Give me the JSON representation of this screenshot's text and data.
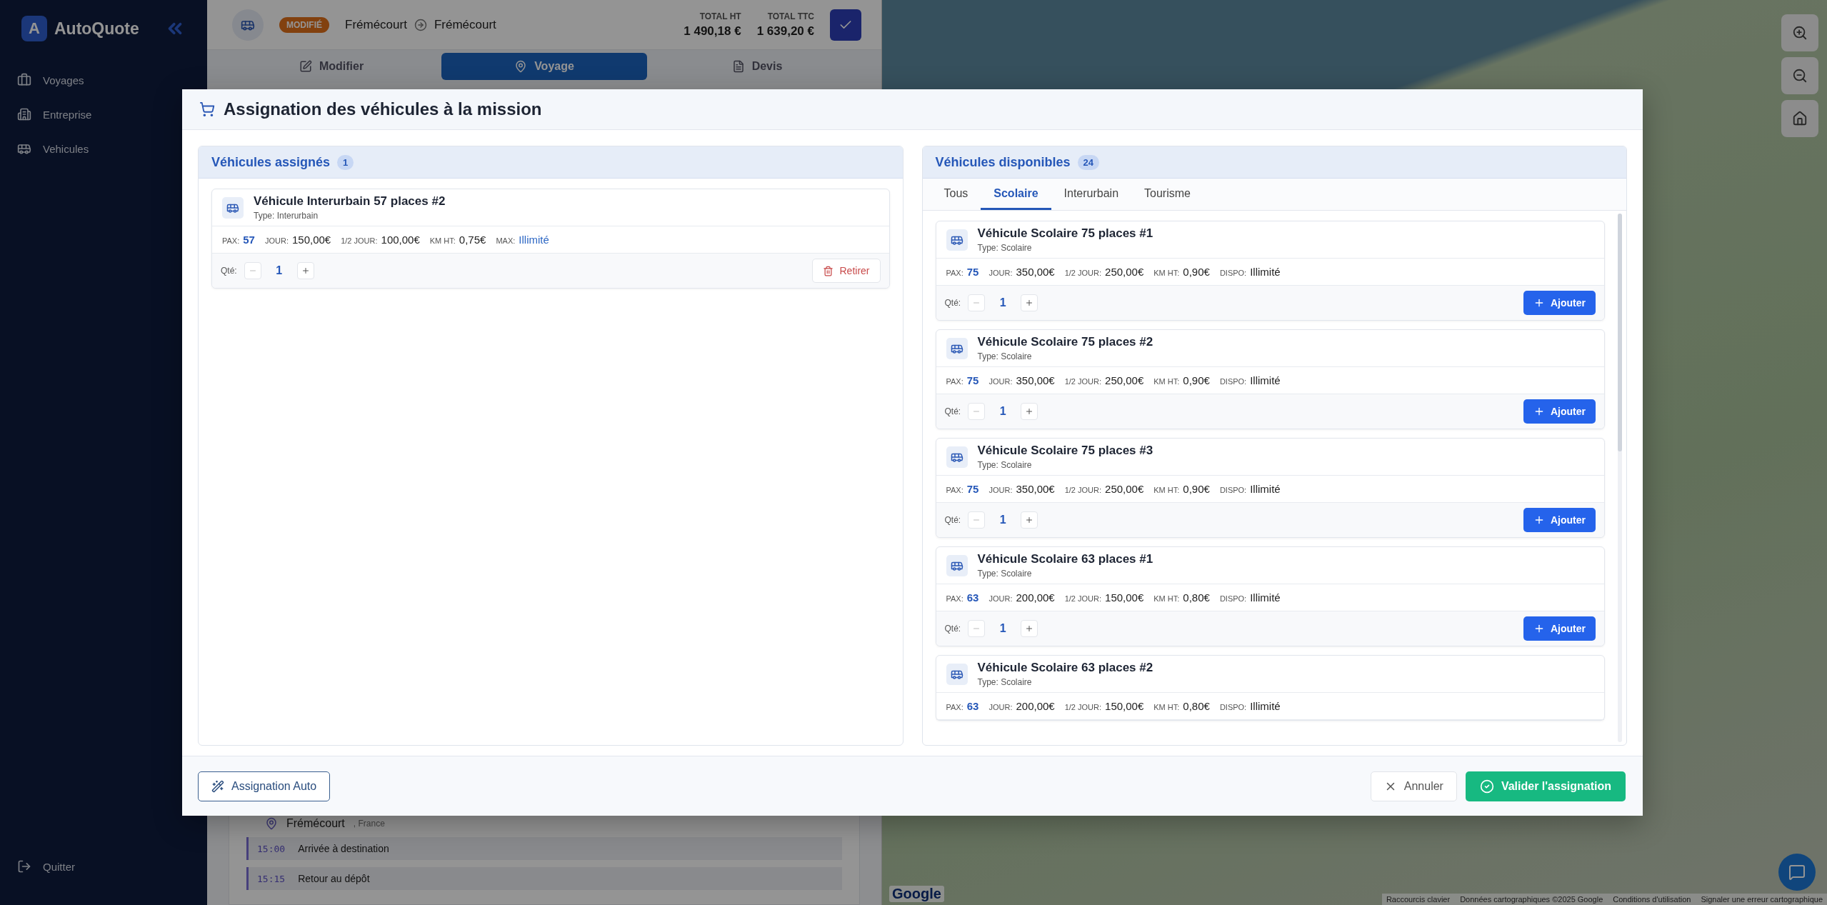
{
  "sidebar": {
    "logo": {
      "mark": "A",
      "name": "AutoQuote"
    },
    "items": [
      {
        "label": "Voyages"
      },
      {
        "label": "Entreprise"
      },
      {
        "label": "Vehicules"
      }
    ],
    "quit": "Quitter"
  },
  "topbar": {
    "status": "MODIFIÉ",
    "from": "Frémécourt",
    "to": "Frémécourt",
    "totals": [
      {
        "label": "TOTAL HT",
        "value": "1 490,18 €"
      },
      {
        "label": "TOTAL TTC",
        "value": "1 639,20 €"
      }
    ]
  },
  "tabs": [
    {
      "label": "Modifier",
      "selected": false
    },
    {
      "label": "Voyage",
      "selected": true
    },
    {
      "label": "Devis",
      "selected": false
    }
  ],
  "itinerary": {
    "place": "Frémécourt",
    "country": ", France",
    "steps": [
      {
        "time": "15:00",
        "label": "Arrivée à destination"
      },
      {
        "time": "15:15",
        "label": "Retour au dépôt"
      }
    ]
  },
  "modal": {
    "title": "Assignation des véhicules à la mission",
    "assigned": {
      "title": "Véhicules assignés",
      "count": "1",
      "vehicles": [
        {
          "name": "Véhicule Interurbain 57 places #2",
          "type": "Type: Interurbain",
          "stats": [
            {
              "label": "PAX:",
              "value": "57",
              "kind": "count"
            },
            {
              "label": "JOUR:",
              "value": "150,00€",
              "kind": "price"
            },
            {
              "label": "1/2 JOUR:",
              "value": "100,00€",
              "kind": "price"
            },
            {
              "label": "KM HT:",
              "value": "0,75€",
              "kind": "price"
            },
            {
              "label": "MAX:",
              "value": "Illimité",
              "kind": "link"
            }
          ],
          "qty_label": "Qté:",
          "qty": "1",
          "action": {
            "kind": "remove",
            "label": "Retirer"
          }
        }
      ]
    },
    "available": {
      "title": "Véhicules disponibles",
      "count": "24",
      "tabs": [
        {
          "label": "Tous",
          "selected": false
        },
        {
          "label": "Scolaire",
          "selected": true
        },
        {
          "label": "Interurbain",
          "selected": false
        },
        {
          "label": "Tourisme",
          "selected": false
        }
      ],
      "vehicles": [
        {
          "name": "Véhicule Scolaire 75 places #1",
          "type": "Type: Scolaire",
          "stats": [
            {
              "label": "PAX:",
              "value": "75",
              "kind": "count"
            },
            {
              "label": "JOUR:",
              "value": "350,00€",
              "kind": "price"
            },
            {
              "label": "1/2 JOUR:",
              "value": "250,00€",
              "kind": "price"
            },
            {
              "label": "KM HT:",
              "value": "0,90€",
              "kind": "price"
            },
            {
              "label": "DISPO:",
              "value": "Illimité",
              "kind": "price"
            }
          ],
          "qty_label": "Qté:",
          "qty": "1",
          "action": {
            "kind": "add",
            "label": "Ajouter"
          }
        },
        {
          "name": "Véhicule Scolaire 75 places #2",
          "type": "Type: Scolaire",
          "stats": [
            {
              "label": "PAX:",
              "value": "75",
              "kind": "count"
            },
            {
              "label": "JOUR:",
              "value": "350,00€",
              "kind": "price"
            },
            {
              "label": "1/2 JOUR:",
              "value": "250,00€",
              "kind": "price"
            },
            {
              "label": "KM HT:",
              "value": "0,90€",
              "kind": "price"
            },
            {
              "label": "DISPO:",
              "value": "Illimité",
              "kind": "price"
            }
          ],
          "qty_label": "Qté:",
          "qty": "1",
          "action": {
            "kind": "add",
            "label": "Ajouter"
          }
        },
        {
          "name": "Véhicule Scolaire 75 places #3",
          "type": "Type: Scolaire",
          "stats": [
            {
              "label": "PAX:",
              "value": "75",
              "kind": "count"
            },
            {
              "label": "JOUR:",
              "value": "350,00€",
              "kind": "price"
            },
            {
              "label": "1/2 JOUR:",
              "value": "250,00€",
              "kind": "price"
            },
            {
              "label": "KM HT:",
              "value": "0,90€",
              "kind": "price"
            },
            {
              "label": "DISPO:",
              "value": "Illimité",
              "kind": "price"
            }
          ],
          "qty_label": "Qté:",
          "qty": "1",
          "action": {
            "kind": "add",
            "label": "Ajouter"
          }
        },
        {
          "name": "Véhicule Scolaire 63 places #1",
          "type": "Type: Scolaire",
          "stats": [
            {
              "label": "PAX:",
              "value": "63",
              "kind": "count"
            },
            {
              "label": "JOUR:",
              "value": "200,00€",
              "kind": "price"
            },
            {
              "label": "1/2 JOUR:",
              "value": "150,00€",
              "kind": "price"
            },
            {
              "label": "KM HT:",
              "value": "0,80€",
              "kind": "price"
            },
            {
              "label": "DISPO:",
              "value": "Illimité",
              "kind": "price"
            }
          ],
          "qty_label": "Qté:",
          "qty": "1",
          "action": {
            "kind": "add",
            "label": "Ajouter"
          }
        },
        {
          "name": "Véhicule Scolaire 63 places #2",
          "type": "Type: Scolaire",
          "stats": [
            {
              "label": "PAX:",
              "value": "63",
              "kind": "count"
            },
            {
              "label": "JOUR:",
              "value": "200,00€",
              "kind": "price"
            },
            {
              "label": "1/2 JOUR:",
              "value": "150,00€",
              "kind": "price"
            },
            {
              "label": "KM HT:",
              "value": "0,80€",
              "kind": "price"
            },
            {
              "label": "DISPO:",
              "value": "Illimité",
              "kind": "price"
            }
          ]
        }
      ]
    },
    "footer": {
      "auto": "Assignation Auto",
      "cancel": "Annuler",
      "confirm": "Valider l'assignation"
    }
  },
  "map": {
    "logo": "Google",
    "attribution": [
      "Raccourcis clavier",
      "Données cartographiques ©2025 Google",
      "Conditions d'utilisation",
      "Signaler une erreur cartographique"
    ]
  }
}
